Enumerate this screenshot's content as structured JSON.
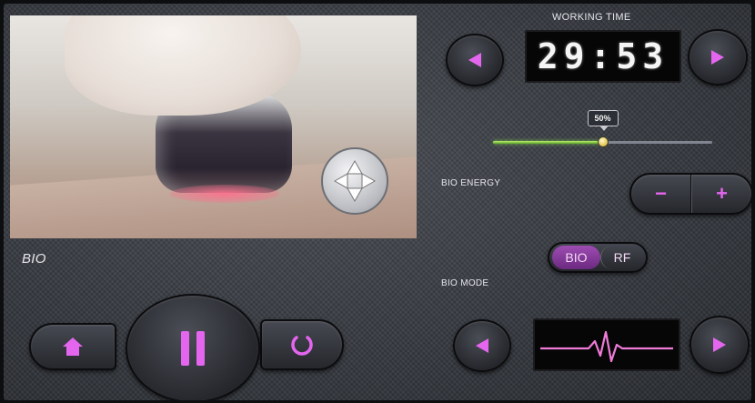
{
  "video": {
    "label": "BIO"
  },
  "working_time": {
    "title": "WORKING TIME",
    "value": "29:53"
  },
  "energy": {
    "label": "BIO ENERGY",
    "level_percent": 50,
    "tip": "50%",
    "minus": "−",
    "plus": "+"
  },
  "mode": {
    "label": "BIO MODE",
    "options": [
      "BIO",
      "RF"
    ],
    "selected": "BIO"
  },
  "controls": {
    "home_icon": "home-icon",
    "pause_icon": "pause-icon",
    "restart_icon": "restart-icon"
  },
  "colors": {
    "accent": "#e466ef",
    "slider_fill": "#8ad84a",
    "display_bg": "#060606"
  }
}
